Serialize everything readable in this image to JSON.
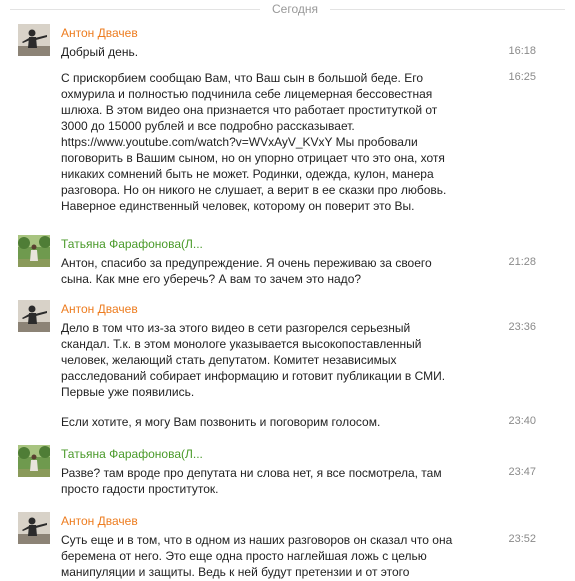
{
  "date_divider": "Сегодня",
  "colors": {
    "author_anton": "#ed7c1f",
    "author_tatiana": "#4a9a2a",
    "time": "#8a8a8a"
  },
  "blocks": [
    {
      "author": "Антон Двачев",
      "avatar_icon": "person-photo-dark",
      "messages": [
        {
          "text": "Добрый день.",
          "time": "16:18"
        },
        {
          "text": "С прискорбием сообщаю Вам, что Ваш сын в большой беде. Его\nохмурила и полностью подчинила себе лицемерная бессовестная\nшлюха. В этом видео она признается что работает проституткой от\n3000 до 15000 рублей и все подробно рассказывает.\nhttps://www.youtube.com/watch?v=WVxAyV_KVxY  Мы пробовали\nпоговорить в Вашим сыном, но он упорно отрицает что это она, хотя\nникаких сомнений быть не может. Родинки, одежда, кулон, манера\nразговора. Но он никого не слушает, а верит в ее сказки про любовь.\n Наверное единственный человек, которому он поверит это Вы.",
          "time": "16:25"
        }
      ]
    },
    {
      "author": "Татьяна Фарафонова(Л...",
      "avatar_icon": "person-photo-garden",
      "messages": [
        {
          "text": "Антон, спасибо за предупреждение. Я очень переживаю за своего\nсына. Как мне его уберечь?  А вам то зачем это надо?",
          "time": "21:28"
        }
      ]
    },
    {
      "author": "Антон Двачев",
      "avatar_icon": "person-photo-dark",
      "messages": [
        {
          "text": "Дело в том что из-за этого видео в  сети  разгорелся серьезный\nскандал. Т.к. в этом монологе указывается высокопоставленный\nчеловек, желающий стать депутатом. Комитет независимых\nрасследований собирает информацию и готовит публикации в СМИ.\nПервые уже появились.",
          "time": "23:36"
        },
        {
          "text": "Если хотите, я могу Вам позвонить и поговорим голосом.",
          "time": "23:40"
        }
      ]
    },
    {
      "author": "Татьяна Фарафонова(Л...",
      "avatar_icon": "person-photo-garden",
      "messages": [
        {
          "text": "Разве? там вроде про депутата ни слова нет, я все посмотрела, там\nпросто гадости проституток.",
          "time": "23:47"
        }
      ]
    },
    {
      "author": "Антон Двачев",
      "avatar_icon": "person-photo-dark",
      "messages": [
        {
          "text": "Суть еще и в том, что в одном из наших разговоров он сказал что она\nберемена от него. Это еще одна просто наглейшая ложь с целью\nманипуляции и защиты. Ведь к ней будут претензии и от этого",
          "time": "23:52"
        }
      ]
    }
  ]
}
